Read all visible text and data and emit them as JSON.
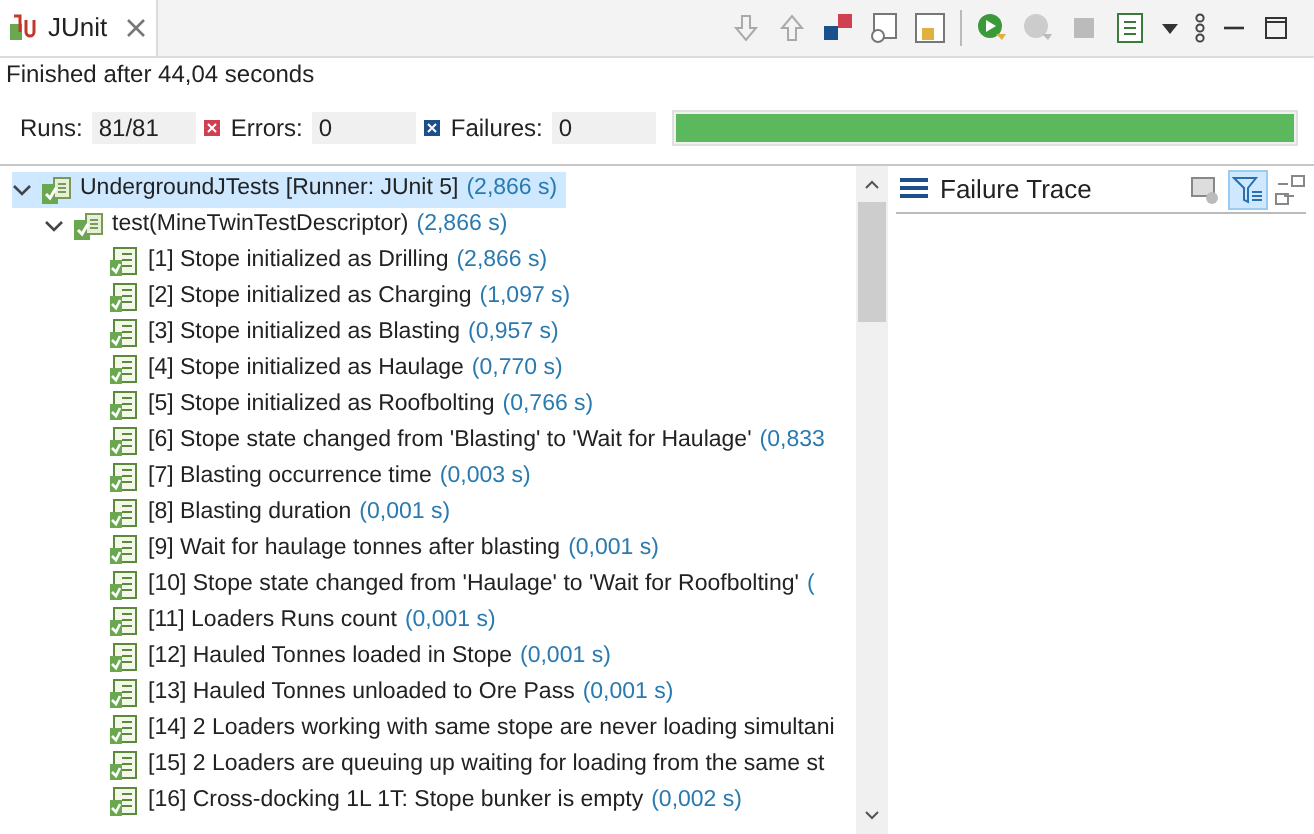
{
  "view_tab": {
    "title": "JUnit"
  },
  "status": "Finished after 44,04 seconds",
  "counters": [
    {
      "kind": "runs",
      "label": "Runs:",
      "value": "81/81"
    },
    {
      "kind": "errors",
      "label": "Errors:",
      "value": "0"
    },
    {
      "kind": "failures",
      "label": "Failures:",
      "value": "0"
    }
  ],
  "progress": {
    "level": 1
  },
  "tree": [
    {
      "name": "UndergroundJTests [Runner: JUnit 5]",
      "time": "(2,866 s)",
      "selected": true,
      "expanded": true,
      "children": [
        {
          "name": "test(MineTwinTestDescriptor)",
          "time": "(2,866 s)",
          "selected": false,
          "expanded": true,
          "children": [
            {
              "name": "[1] Stope initialized as Drilling",
              "time": "(2,866 s)",
              "selected": false
            },
            {
              "name": "[2] Stope initialized as Charging",
              "time": "(1,097 s)",
              "selected": false
            },
            {
              "name": "[3] Stope initialized as Blasting",
              "time": "(0,957 s)",
              "selected": false
            },
            {
              "name": "[4] Stope initialized as Haulage",
              "time": "(0,770 s)",
              "selected": false
            },
            {
              "name": "[5] Stope initialized as Roofbolting",
              "time": "(0,766 s)",
              "selected": false
            },
            {
              "name": "[6] Stope state changed from 'Blasting' to 'Wait for Haulage'",
              "time": "(0,833",
              "selected": false
            },
            {
              "name": "[7] Blasting occurrence time",
              "time": "(0,003 s)",
              "selected": false
            },
            {
              "name": "[8] Blasting duration",
              "time": "(0,001 s)",
              "selected": false
            },
            {
              "name": "[9] Wait for haulage tonnes after blasting",
              "time": "(0,001 s)",
              "selected": false
            },
            {
              "name": "[10] Stope state changed from 'Haulage' to 'Wait for Roofbolting'",
              "time": "(",
              "selected": false
            },
            {
              "name": "[11] Loaders Runs count",
              "time": "(0,001 s)",
              "selected": false
            },
            {
              "name": "[12] Hauled Tonnes loaded in Stope",
              "time": "(0,001 s)",
              "selected": false
            },
            {
              "name": "[13] Hauled Tonnes unloaded to Ore Pass",
              "time": "(0,001 s)",
              "selected": false
            },
            {
              "name": "[14] 2 Loaders working with same stope are never loading simultani",
              "selected": false
            },
            {
              "name": "[15] 2 Loaders are queuing up waiting for loading from the same st",
              "selected": false
            },
            {
              "name": "[16] Cross-docking 1L 1T: Stope bunker is empty",
              "time": "(0,002 s)",
              "selected": false
            }
          ]
        }
      ]
    }
  ],
  "trace_panel": {
    "title": "Failure Trace"
  }
}
